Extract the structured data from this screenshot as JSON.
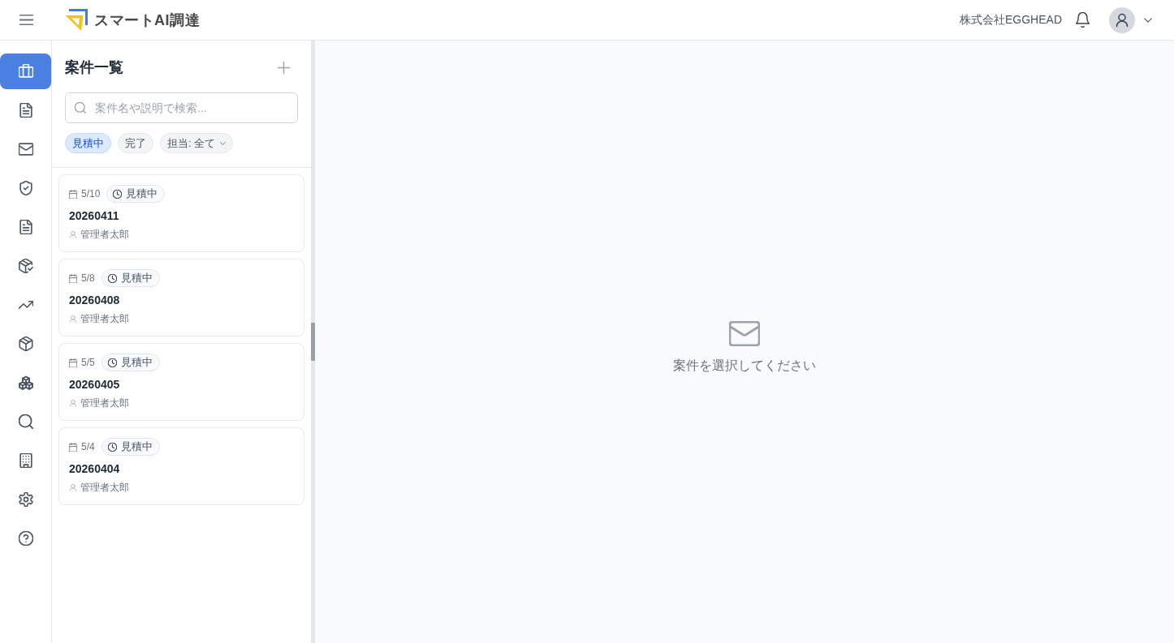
{
  "header": {
    "app_name": "スマートAI調達",
    "company": "株式会社EGGHEAD"
  },
  "nav_items": [
    {
      "selected": true
    },
    {
      "selected": false
    },
    {
      "selected": false
    },
    {
      "selected": false
    },
    {
      "selected": false
    },
    {
      "selected": false
    },
    {
      "selected": false
    },
    {
      "selected": false
    },
    {
      "selected": false
    },
    {
      "selected": false
    },
    {
      "selected": false
    },
    {
      "selected": false
    },
    {
      "selected": false
    }
  ],
  "case_panel": {
    "title": "案件一覧",
    "search": {
      "placeholder": "案件名や説明で検索..."
    },
    "filters": [
      {
        "label": "見積中",
        "kind": "toggle",
        "selected": true
      },
      {
        "label": "完了",
        "kind": "toggle",
        "selected": false
      },
      {
        "label": "担当: 全て",
        "kind": "dropdown",
        "selected": false
      }
    ],
    "cases": [
      {
        "date": "5/10",
        "status": "見積中",
        "title": "20260411",
        "assignee": "管理者太郎",
        "selected": false
      },
      {
        "date": "5/8",
        "status": "見積中",
        "title": "20260408",
        "assignee": "管理者太郎",
        "selected": false
      },
      {
        "date": "5/5",
        "status": "見積中",
        "title": "20260405",
        "assignee": "管理者太郎",
        "selected": false
      },
      {
        "date": "5/4",
        "status": "見積中",
        "title": "20260404",
        "assignee": "管理者太郎",
        "selected": false
      }
    ]
  },
  "detail": {
    "empty_message": "案件を選択してください"
  }
}
